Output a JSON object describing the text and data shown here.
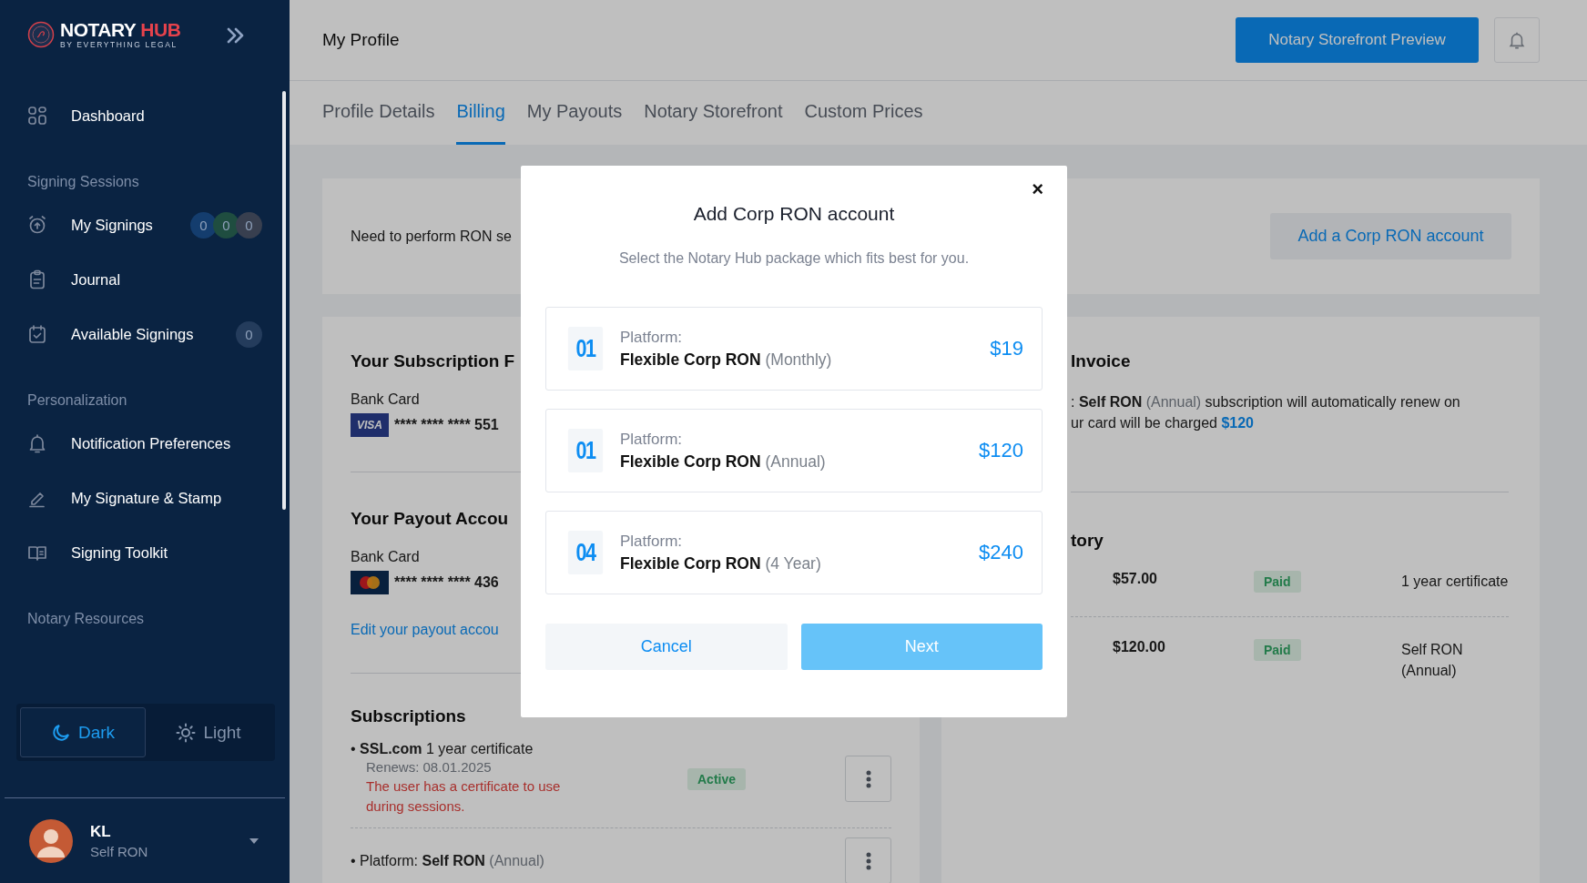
{
  "sidebar": {
    "logo": {
      "title": "NOTARY",
      "accent": "HUB",
      "tagline": "BY EVERYTHING LEGAL"
    },
    "sections": [
      {
        "items": [
          {
            "label": "Dashboard"
          }
        ]
      },
      {
        "heading": "Signing Sessions",
        "items": [
          {
            "label": "My Signings",
            "badges": [
              {
                "text": "0",
                "color": "#143d6e"
              },
              {
                "text": "0",
                "color": "#1f4d40"
              },
              {
                "text": "0",
                "color": "#383f4f"
              }
            ]
          },
          {
            "label": "Journal"
          },
          {
            "label": "Available Signings",
            "badges": [
              {
                "text": "0",
                "color": "#243c5c"
              }
            ]
          }
        ]
      },
      {
        "heading": "Personalization",
        "items": [
          {
            "label": "Notification Preferences"
          },
          {
            "label": "My Signature & Stamp"
          },
          {
            "label": "Signing Toolkit"
          }
        ]
      },
      {
        "heading": "Notary Resources"
      }
    ],
    "theme": [
      {
        "label": "Dark",
        "selected": true
      },
      {
        "label": "Light",
        "selected": false
      }
    ],
    "user": {
      "name": "KL",
      "role": "Self RON"
    }
  },
  "header": {
    "title": "My Profile",
    "preview_button": "Notary Storefront Preview"
  },
  "tabs": [
    {
      "label": "Profile Details",
      "selected": false
    },
    {
      "label": "Billing",
      "selected": true
    },
    {
      "label": "My Payouts",
      "selected": false
    },
    {
      "label": "Notary Storefront",
      "selected": false
    },
    {
      "label": "Custom Prices",
      "selected": false
    }
  ],
  "corp_card": {
    "text": "Need to perform RON se",
    "button": "Add a Corp RON account"
  },
  "subscription_payment": {
    "heading": "Your Subscription F",
    "card_label": "Bank Card",
    "card": {
      "kind": "visa",
      "brand": "VISA",
      "number": "**** **** **** 551"
    }
  },
  "payout_account": {
    "heading": "Your Payout Accou",
    "card_label": "Bank Card",
    "card": {
      "kind": "mastercard",
      "number": "**** **** **** 436"
    },
    "link": "Edit your payout accou"
  },
  "subscriptions": {
    "heading": "Subscriptions",
    "items": [
      {
        "bullet": "•",
        "name": "SSL.com",
        "detail": "1 year certificate",
        "detail_muted": false,
        "renews": "Renews: 08.01.2025",
        "warning": "The user has a certificate to use during sessions.",
        "status": "Active"
      },
      {
        "bullet": "•",
        "prefix": "Platform:",
        "name": "Self RON",
        "detail": "(Annual)",
        "detail_muted": true
      }
    ]
  },
  "invoice": {
    "heading": "Invoice",
    "lead": ":",
    "plan": "Self RON",
    "term": "(Annual)",
    "renew_text": "subscription will automatically renew on",
    "charge_text": "ur card will be charged",
    "amount": "$120"
  },
  "history": {
    "heading": "tory",
    "rows": [
      {
        "amount": "$57.00",
        "status": "Paid",
        "description": "1 year certificate"
      },
      {
        "amount": "$120.00",
        "status": "Paid",
        "description": "Self RON (Annual)"
      }
    ]
  },
  "modal": {
    "close": "×",
    "title": "Add Corp RON account",
    "subtitle": "Select the Notary Hub package which fits best for you.",
    "options": [
      {
        "number": "01",
        "label": "Platform:",
        "name": "Flexible Corp RON",
        "term": "(Monthly)",
        "price": "$19",
        "selected": false
      },
      {
        "number": "01",
        "label": "Platform:",
        "name": "Flexible Corp RON",
        "term": "(Annual)",
        "price": "$120",
        "selected": false
      },
      {
        "number": "04",
        "label": "Platform:",
        "name": "Flexible Corp RON",
        "term": "(4 Year)",
        "price": "$240",
        "selected": false
      }
    ],
    "cancel": "Cancel",
    "next": {
      "label": "Next",
      "disabled": true
    }
  }
}
